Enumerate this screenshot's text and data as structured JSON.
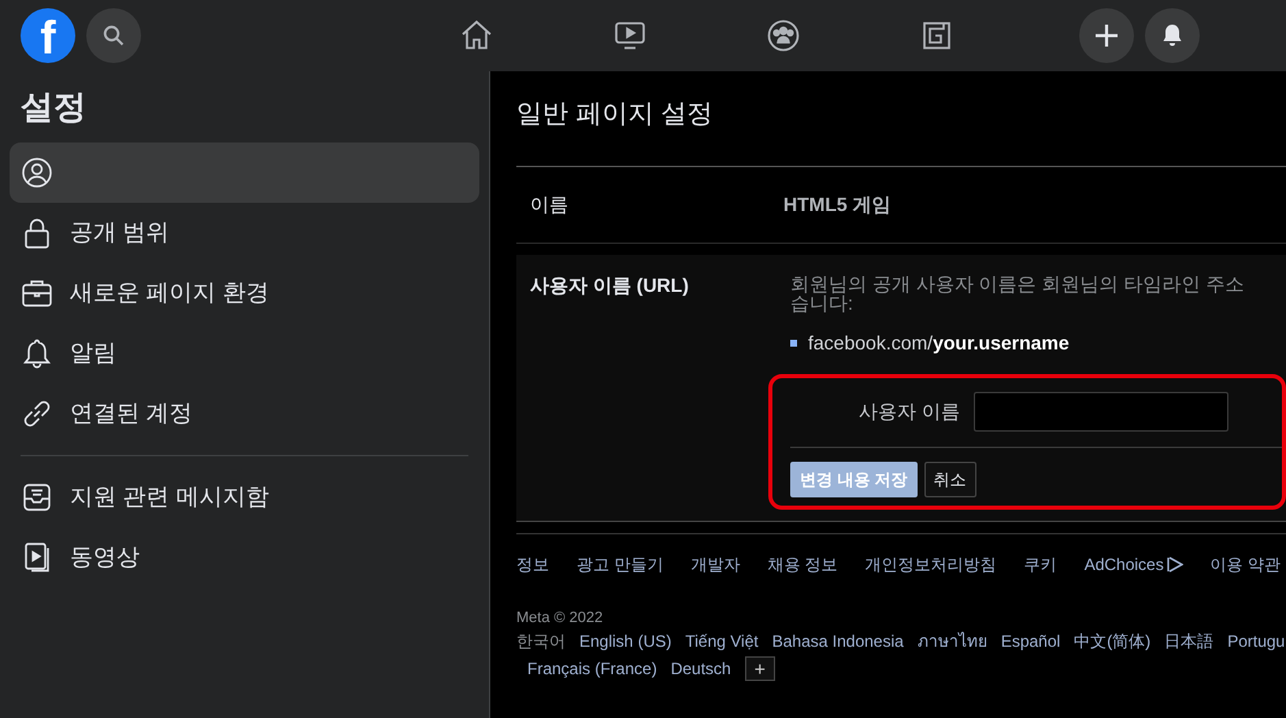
{
  "topbar": {
    "logo": "f",
    "nav": [
      {
        "kind": "home",
        "selected": false
      },
      {
        "kind": "watch",
        "selected": false
      },
      {
        "kind": "groups",
        "selected": false
      },
      {
        "kind": "gaming",
        "selected": false
      }
    ]
  },
  "sidebar": {
    "title": "설정",
    "groups": [
      [
        {
          "kind": "profile",
          "selected": true
        },
        {
          "kind": "lock",
          "label": "공개 범위",
          "selected": false
        },
        {
          "kind": "briefcase",
          "label": "새로운 페이지 환경",
          "selected": false
        },
        {
          "kind": "bell",
          "label": "알림",
          "selected": false
        },
        {
          "kind": "link",
          "label": "연결된 계정",
          "selected": false
        }
      ],
      [
        {
          "kind": "inbox",
          "label": "지원 관련 메시지함",
          "selected": false
        },
        {
          "kind": "video",
          "label": "동영상",
          "selected": false
        }
      ]
    ]
  },
  "main": {
    "title": "일반 페이지 설정",
    "name_row": {
      "label": "이름",
      "value": "HTML5 게임"
    },
    "username_row": {
      "label": "사용자 이름 (URL)",
      "description": [
        "회원님의 공개 사용자 이름은 회원님의 타임라인 주소",
        "습니다:"
      ],
      "example_prefix": "facebook.com/",
      "example_bold": "your.username",
      "field_label": "사용자 이름",
      "save": "변경 내용 저장",
      "cancel": "취소"
    }
  },
  "footer": {
    "links": [
      "정보",
      "광고 만들기",
      "개발자",
      "채용 정보",
      "개인정보처리방침",
      "쿠키",
      "AdChoices",
      "이용 약관"
    ],
    "copyright": "Meta © 2022",
    "current_language": "한국어",
    "languages": [
      "English (US)",
      "Tiếng Việt",
      "Bahasa Indonesia",
      "ภาษาไทย",
      "Español",
      "中文(简体)",
      "日本語",
      "Portugu",
      "Français (France)",
      "Deutsch"
    ],
    "more": "+"
  }
}
